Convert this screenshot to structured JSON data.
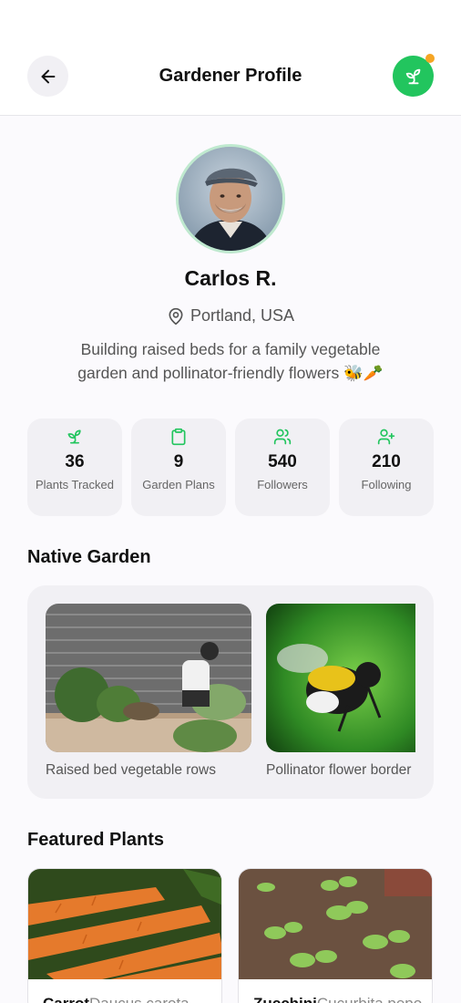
{
  "header": {
    "title": "Gardener Profile",
    "back_icon": "arrow-left-icon",
    "app_icon": "sprout-icon",
    "accent": "#22c55e",
    "notification_color": "#f5a524"
  },
  "profile": {
    "name": "Carlos R.",
    "location": "Portland, USA",
    "bio": "Building raised beds for a family vegetable garden and pollinator-friendly flowers 🐝🥕"
  },
  "stats": [
    {
      "icon": "sprout-icon",
      "value": "36",
      "label": "Plants Tracked"
    },
    {
      "icon": "clipboard-icon",
      "value": "9",
      "label": "Garden Plans"
    },
    {
      "icon": "users-icon",
      "value": "540",
      "label": "Followers"
    },
    {
      "icon": "user-plus-icon",
      "value": "210",
      "label": "Following"
    }
  ],
  "native_garden": {
    "title": "Native Garden",
    "items": [
      {
        "caption": "Raised bed vegetable rows"
      },
      {
        "caption": "Pollinator flower border"
      }
    ]
  },
  "featured": {
    "title": "Featured Plants",
    "items": [
      {
        "common": "Carrot",
        "scientific": "Daucus carota"
      },
      {
        "common": "Zucchini",
        "scientific": "Cucurbita pepo"
      }
    ]
  }
}
